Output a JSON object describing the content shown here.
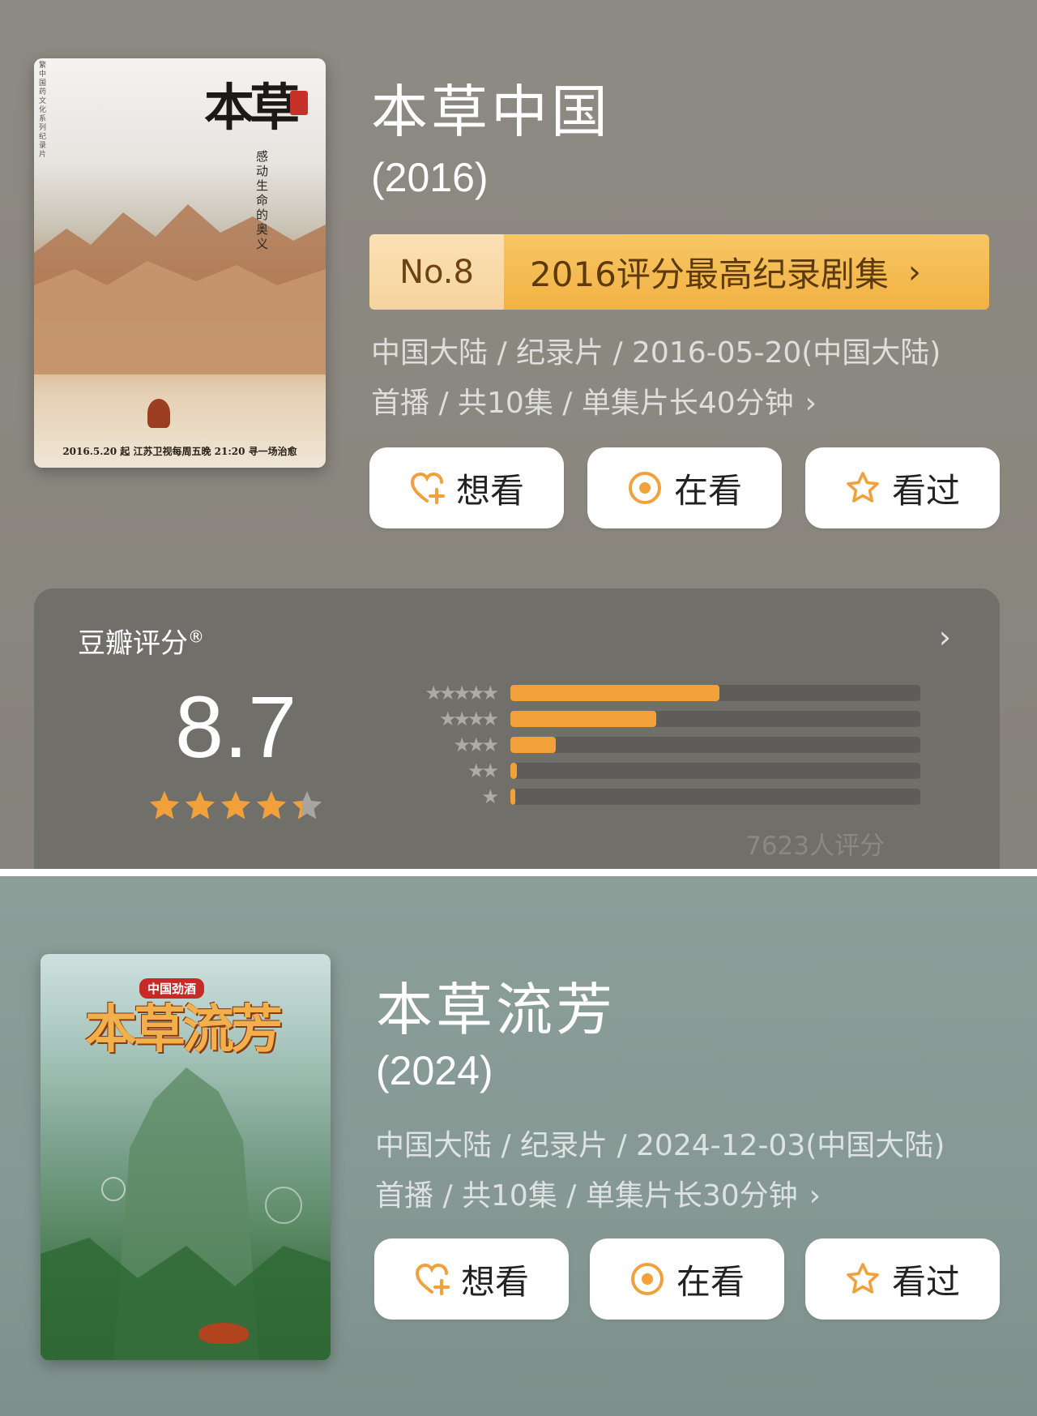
{
  "items": [
    {
      "title": "本草中国",
      "year": "(2016)",
      "rank": {
        "no": "No.8",
        "text": "2016评分最高纪录剧集",
        "arrow": "›"
      },
      "meta_line1": "中国大陆 / 纪录片 / 2016-05-20(中国大陆)",
      "meta_line2": "首播 / 共10集 / 单集片长40分钟",
      "meta_chev": "›",
      "poster": {
        "title_art": "本草",
        "vertical_text": "感动生命的奥义",
        "side_text": "繁中国药文化系列纪录片",
        "bottom_text": "2016.5.20 起 江苏卫视每周五晚 21:20 寻一场治愈"
      },
      "buttons": {
        "want": "想看",
        "watching": "在看",
        "watched": "看过"
      }
    },
    {
      "title": "本草流芳",
      "year": "(2024)",
      "meta_line1": "中国大陆 / 纪录片 / 2024-12-03(中国大陆)",
      "meta_line2": "首播 / 共10集 / 单集片长30分钟",
      "meta_chev": "›",
      "poster": {
        "badge": "中国劲酒",
        "title_art": "本草流芳"
      },
      "buttons": {
        "want": "想看",
        "watching": "在看",
        "watched": "看过"
      }
    }
  ],
  "rating": {
    "label": "豆瓣评分",
    "reg": "®",
    "chev": "›",
    "score": "8.7",
    "stars_fraction": 0.87,
    "distribution": [
      {
        "stars": "★★★★★",
        "fraction": 0.51
      },
      {
        "stars": "★★★★",
        "fraction": 0.355
      },
      {
        "stars": "★★★",
        "fraction": 0.11
      },
      {
        "stars": "★★",
        "fraction": 0.015
      },
      {
        "stars": "★",
        "fraction": 0.012
      }
    ],
    "raters": "7623人评分"
  },
  "colors": {
    "accent": "#f2a13a",
    "panel1_bg": "#8a877f",
    "panel2_bg": "#869893",
    "rating_card": "#716f6a"
  },
  "icons": {
    "want": "heart-plus-icon",
    "watching": "target-icon",
    "watched": "star-outline-icon"
  }
}
